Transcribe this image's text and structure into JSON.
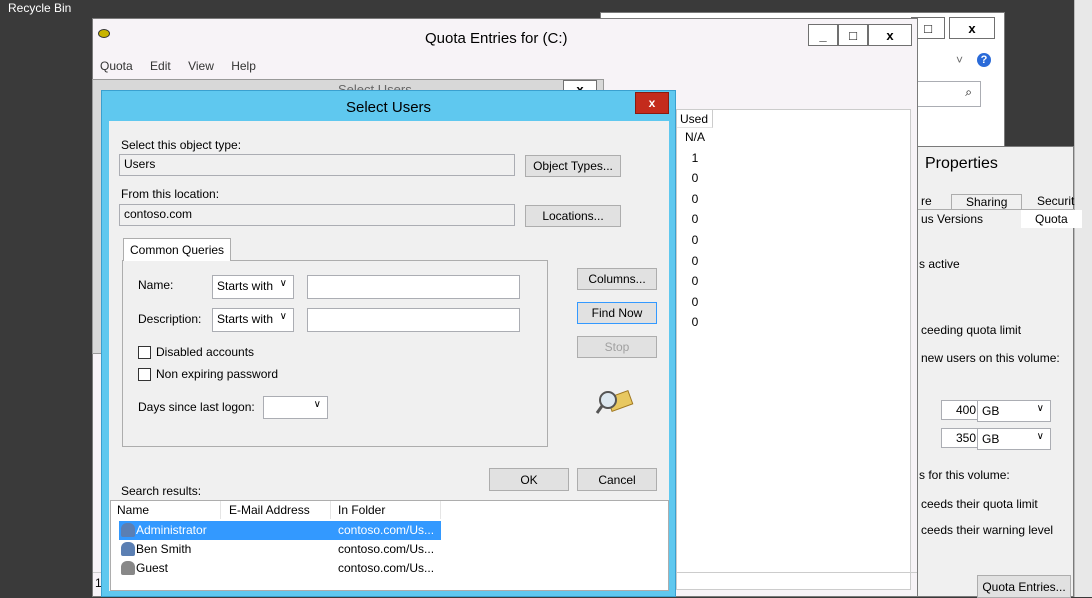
{
  "desktop": {
    "recycle_bin": "Recycle Bin"
  },
  "back_window": {
    "close_label": "x",
    "max_label": "□",
    "dropdown": "˅",
    "help": "?",
    "search_icon": "⌕"
  },
  "quota_window": {
    "title": "Quota Entries for  (C:)",
    "min_label": "_",
    "max_label": "□",
    "close_label": "x",
    "menu": [
      "Quota",
      "Edit",
      "View",
      "Help"
    ],
    "used_header": "Used",
    "used_values": [
      "N/A",
      "1",
      "0",
      "0",
      "0",
      "0",
      "0",
      "0",
      "0",
      "0"
    ],
    "status_text": "1"
  },
  "ghost_dialog": {
    "title": "Select Users",
    "close_label": "x"
  },
  "select_users": {
    "title": "Select Users",
    "close_label": "x",
    "object_type_label": "Select this object type:",
    "object_type_value": "Users",
    "object_types_button": "Object Types...",
    "location_label": "From this location:",
    "location_value": "contoso.com",
    "locations_button": "Locations...",
    "tab_label": "Common Queries",
    "name_label": "Name:",
    "name_mode": "Starts with",
    "description_label": "Description:",
    "description_mode": "Starts with",
    "disabled_accounts": "Disabled accounts",
    "non_expiring": "Non expiring password",
    "days_label": "Days since last logon:",
    "columns_button": "Columns...",
    "find_now_button": "Find Now",
    "stop_button": "Stop",
    "ok_button": "OK",
    "cancel_button": "Cancel",
    "search_results_label": "Search results:",
    "columns": [
      "Name",
      "E-Mail Address",
      "In Folder"
    ],
    "results": [
      {
        "name": "Administrator",
        "email": "",
        "folder": "contoso.com/Us..."
      },
      {
        "name": "Ben Smith",
        "email": "",
        "folder": "contoso.com/Us..."
      },
      {
        "name": "Guest",
        "email": "",
        "folder": "contoso.com/Us..."
      }
    ]
  },
  "properties": {
    "title": "Properties",
    "tabs_row1": [
      "re",
      "Sharing",
      "Securit"
    ],
    "tabs_row2": [
      "us Versions",
      "Quota"
    ],
    "status_active": "s active",
    "exceeding": "ceeding quota limit",
    "new_users": "new users on this volume:",
    "limit_value": "400",
    "limit_unit": "GB",
    "warn_value": "350",
    "warn_unit": "GB",
    "for_volume": "s for this volume:",
    "exceeds_limit": "ceeds their quota limit",
    "exceeds_warning": "ceeds their warning level",
    "quota_entries_button": "Quota Entries..."
  },
  "colors": {
    "dialog_title": "#5fc8ef",
    "close_red": "#c42b1c",
    "selection": "#3399ff"
  }
}
